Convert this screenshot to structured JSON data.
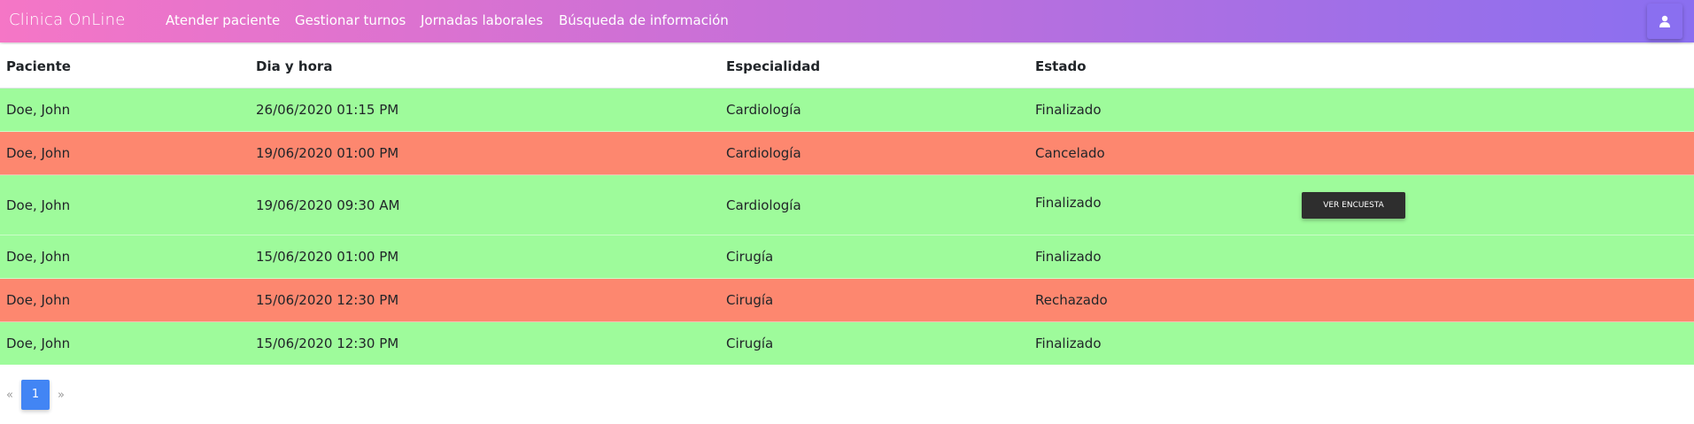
{
  "navbar": {
    "brand": "Clinica OnLine",
    "links": [
      {
        "label": "Atender paciente"
      },
      {
        "label": "Gestionar turnos"
      },
      {
        "label": "Jornadas laborales"
      },
      {
        "label": "Búsqueda de información"
      }
    ],
    "user_icon": "user-icon"
  },
  "table": {
    "headers": [
      "Paciente",
      "Dia y hora",
      "Especialidad",
      "Estado"
    ],
    "rows": [
      {
        "paciente": "Doe, John",
        "fecha": "26/06/2020 01:15 PM",
        "especialidad": "Cardiología",
        "estado": "Finalizado",
        "status": "ok"
      },
      {
        "paciente": "Doe, John",
        "fecha": "19/06/2020 01:00 PM",
        "especialidad": "Cardiología",
        "estado": "Cancelado",
        "status": "bad"
      },
      {
        "paciente": "Doe, John",
        "fecha": "19/06/2020 09:30 AM",
        "especialidad": "Cardiología",
        "estado": "Finalizado",
        "status": "ok",
        "action": "Ver encuesta"
      },
      {
        "paciente": "Doe, John",
        "fecha": "15/06/2020 01:00 PM",
        "especialidad": "Cirugía",
        "estado": "Finalizado",
        "status": "ok"
      },
      {
        "paciente": "Doe, John",
        "fecha": "15/06/2020 12:30 PM",
        "especialidad": "Cirugía",
        "estado": "Rechazado",
        "status": "bad"
      },
      {
        "paciente": "Doe, John",
        "fecha": "15/06/2020 12:30 PM",
        "especialidad": "Cirugía",
        "estado": "Finalizado",
        "status": "ok"
      }
    ]
  },
  "pagination": {
    "prev": "«",
    "current": "1",
    "next": "»"
  },
  "colors": {
    "row_ok": "#9efb9b",
    "row_bad": "#fd876f",
    "page_active": "#4285f4",
    "nav_start": "#f576c6",
    "nav_end": "#8a6ff0"
  }
}
